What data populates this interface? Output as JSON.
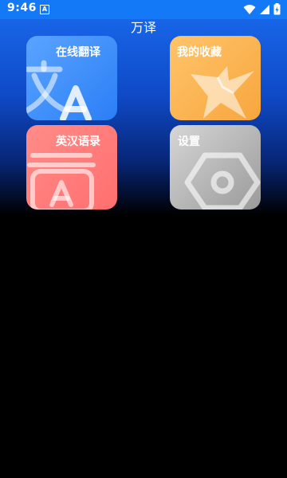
{
  "status_bar": {
    "time": "9:46",
    "notification_letter": "A"
  },
  "app": {
    "title": "万译"
  },
  "tiles": [
    {
      "label": "在线翻译",
      "icon": "translate-icon",
      "color": "#3b8ff8"
    },
    {
      "label": "我的收藏",
      "icon": "star-icon",
      "color": "#f9b04f"
    },
    {
      "label": "英汉语录",
      "icon": "dictionary-icon",
      "color": "#ff7b7b"
    },
    {
      "label": "设置",
      "icon": "settings-icon",
      "color": "#b7b7b7"
    }
  ]
}
